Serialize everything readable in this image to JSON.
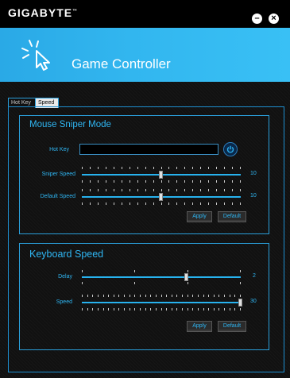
{
  "window": {
    "brand": "GIGABYTE",
    "title": "Game Controller"
  },
  "tabs": [
    {
      "label": "Hot Key",
      "active": false
    },
    {
      "label": "Speed",
      "active": true
    }
  ],
  "mouse_sniper": {
    "title": "Mouse Sniper Mode",
    "hotkey_label": "Hot Key",
    "hotkey_value": "",
    "sniper_speed": {
      "label": "Sniper Speed",
      "value": "10",
      "level": 0.5
    },
    "default_speed": {
      "label": "Default Speed",
      "value": "10",
      "level": 0.5
    },
    "apply_label": "Apply",
    "default_label": "Default"
  },
  "keyboard_speed": {
    "title": "Keyboard Speed",
    "delay": {
      "label": "Delay",
      "value": "2",
      "level": 0.66
    },
    "speed": {
      "label": "Speed",
      "value": "30",
      "level": 1.0
    },
    "apply_label": "Apply",
    "default_label": "Default"
  },
  "colors": {
    "accent": "#2fb6f3",
    "banner": "#32b6ef",
    "background": "#111111"
  }
}
